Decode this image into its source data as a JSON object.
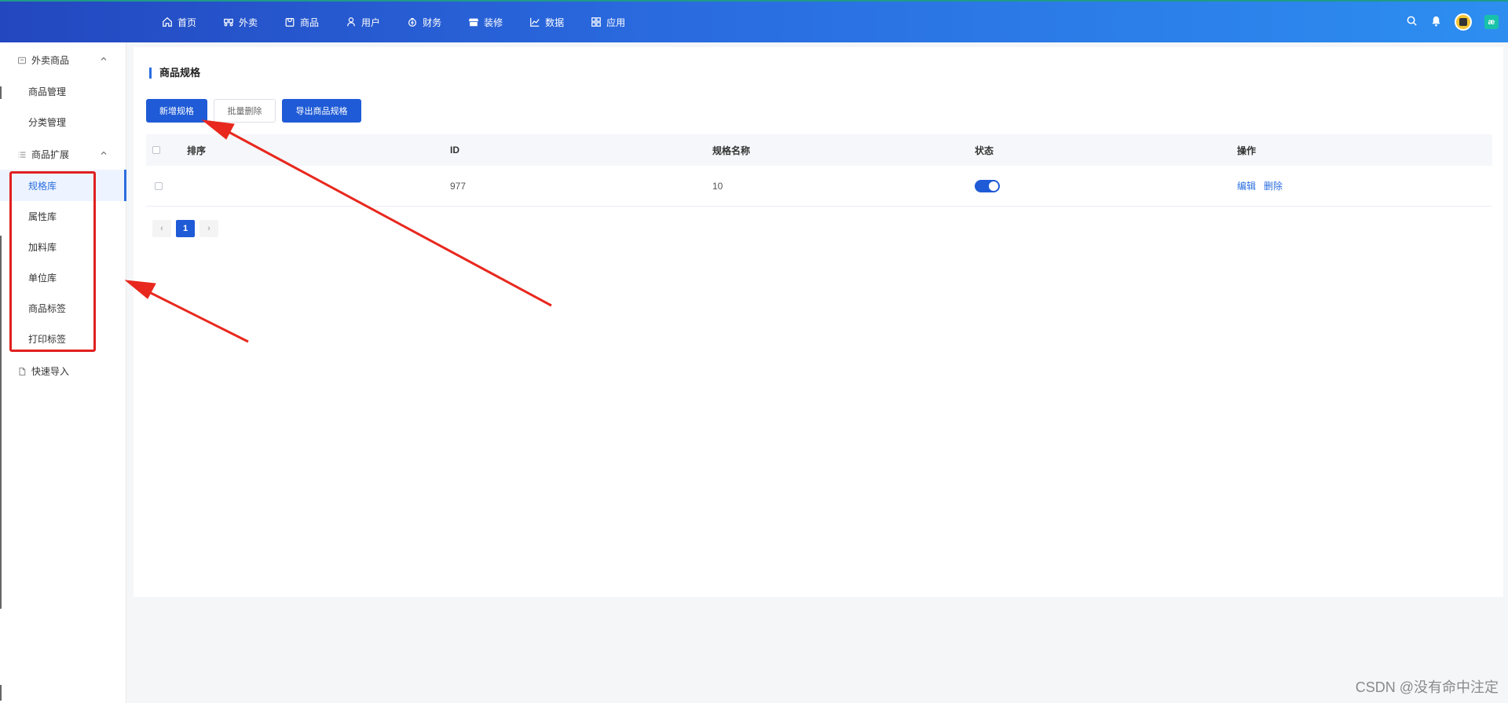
{
  "nav": {
    "items": [
      {
        "label": "首页",
        "icon": "home-icon"
      },
      {
        "label": "外卖",
        "icon": "scooter-icon"
      },
      {
        "label": "商品",
        "icon": "bag-icon"
      },
      {
        "label": "用户",
        "icon": "user-icon"
      },
      {
        "label": "财务",
        "icon": "wallet-icon"
      },
      {
        "label": "装修",
        "icon": "store-icon"
      },
      {
        "label": "数据",
        "icon": "chart-icon"
      },
      {
        "label": "应用",
        "icon": "apps-icon"
      }
    ]
  },
  "topright": {
    "brand_glyph": "æ"
  },
  "sidebar": {
    "groups": [
      {
        "label": "外卖商品",
        "icon": "box-icon",
        "items": [
          "商品管理",
          "分类管理"
        ]
      },
      {
        "label": "商品扩展",
        "icon": "list-icon",
        "items": [
          "规格库",
          "属性库",
          "加料库",
          "单位库",
          "商品标签",
          "打印标签"
        ]
      }
    ],
    "quick_import": "快速导入",
    "active_item": "规格库"
  },
  "page": {
    "title": "商品规格",
    "buttons": {
      "add": "新增规格",
      "batch_delete": "批量删除",
      "export": "导出商品规格"
    }
  },
  "table": {
    "headers": [
      "排序",
      "ID",
      "规格名称",
      "状态",
      "操作"
    ],
    "rows": [
      {
        "sort": "",
        "id": "977",
        "name": "10",
        "status": "on",
        "edit": "编辑",
        "delete": "删除"
      }
    ]
  },
  "pagination": {
    "prev": "‹",
    "current": "1",
    "next": "›"
  },
  "watermark": "CSDN @没有命中注定",
  "colors": {
    "primary": "#1f5bd6",
    "accent": "#2a6ee0",
    "annotation": "#e02020"
  }
}
